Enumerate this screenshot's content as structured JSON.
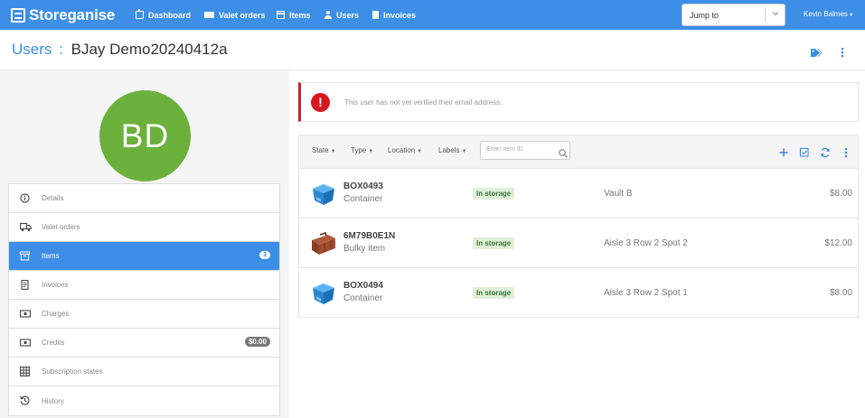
{
  "app": {
    "brand": "Storeganise",
    "accent": "#3d8ee6"
  },
  "nav": {
    "items": [
      {
        "label": "Dashboard",
        "icon": "dashboard-icon"
      },
      {
        "label": "Valet orders",
        "icon": "truck-icon"
      },
      {
        "label": "Items",
        "icon": "box-icon"
      },
      {
        "label": "Users",
        "icon": "user-icon"
      },
      {
        "label": "Invoices",
        "icon": "invoice-icon"
      }
    ],
    "active": "Users",
    "jump_to": "Jump to",
    "user": "Kevin Balmes"
  },
  "header": {
    "section": "Users",
    "separator": ":",
    "name": "BJay Demo20240412a"
  },
  "profile": {
    "initials": "BD",
    "avatar_color": "#6bb13c"
  },
  "menu": [
    {
      "label": "Details",
      "icon": "info-icon"
    },
    {
      "label": "Valet orders",
      "icon": "truck-icon"
    },
    {
      "label": "Items",
      "icon": "box-icon",
      "badge": "3",
      "active": true
    },
    {
      "label": "Invoices",
      "icon": "invoice-icon"
    },
    {
      "label": "Charges",
      "icon": "money-icon"
    },
    {
      "label": "Credits",
      "icon": "money-icon",
      "badge": "$0.00"
    },
    {
      "label": "Subscription states",
      "icon": "table-icon"
    },
    {
      "label": "History",
      "icon": "history-icon"
    }
  ],
  "alert": {
    "text": "This user has not yet verified their email address.",
    "color": "#d9161f"
  },
  "filters": {
    "state": "State",
    "type": "Type",
    "location": "Location",
    "labels": "Labels",
    "search_placeholder": "Enter item ID"
  },
  "items": [
    {
      "code": "BOX0493",
      "type": "Container",
      "state": "In storage",
      "location": "Vault B",
      "price": "$8.00",
      "image": "container-icon"
    },
    {
      "code": "6M79B0E1N",
      "type": "Bulky item",
      "state": "In storage",
      "location": "Aisle 3 Row 2 Spot 2",
      "price": "$12.00",
      "image": "suitcase-icon"
    },
    {
      "code": "BOX0494",
      "type": "Container",
      "state": "In storage",
      "location": "Aisle 3 Row 2 Spot 1",
      "price": "$8.00",
      "image": "container-icon"
    }
  ]
}
